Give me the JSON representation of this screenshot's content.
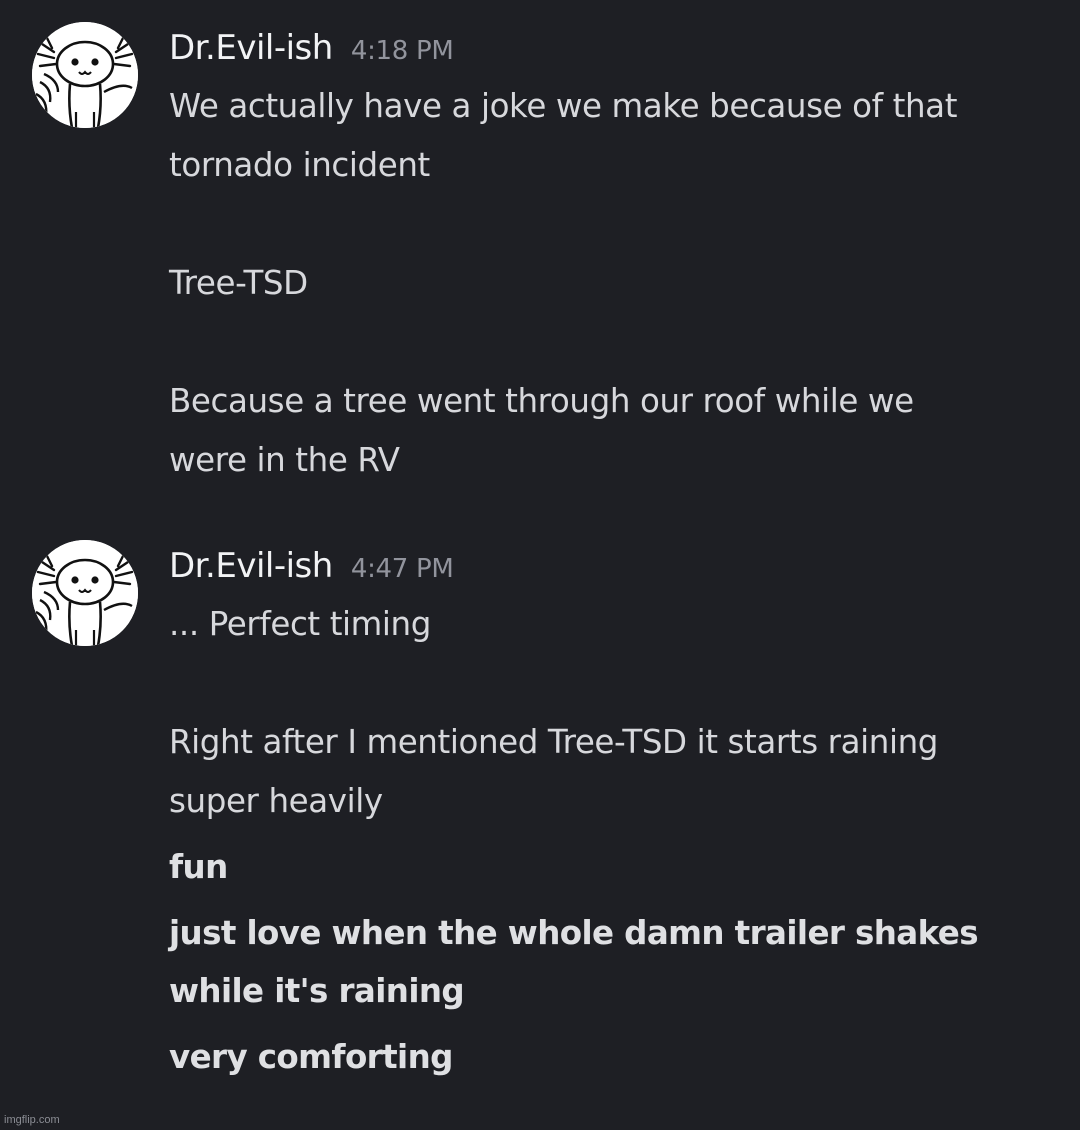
{
  "messages": [
    {
      "username": "Dr.Evil-ish",
      "timestamp": "4:18 PM",
      "lines": [
        "We actually have a joke we make because of that",
        "tornado incident",
        "Tree-TSD",
        "Because a tree went through our roof while we",
        "were in the RV"
      ]
    },
    {
      "username": "Dr.Evil-ish",
      "timestamp": "4:47 PM",
      "lines": [
        "... Perfect timing",
        "Right after I mentioned Tree-TSD it starts raining",
        "super heavily"
      ],
      "followups": [
        "fun",
        "just love when the whole damn trailer shakes",
        "while it's raining",
        "very comforting"
      ]
    }
  ],
  "watermark": "imgflip.com",
  "colors": {
    "background": "#1e1f24",
    "username": "#f2f3f5",
    "timestamp": "#92949d",
    "message_text": "#d7d8dc"
  },
  "icons": {
    "avatar": "axolotl-avatar-icon"
  }
}
